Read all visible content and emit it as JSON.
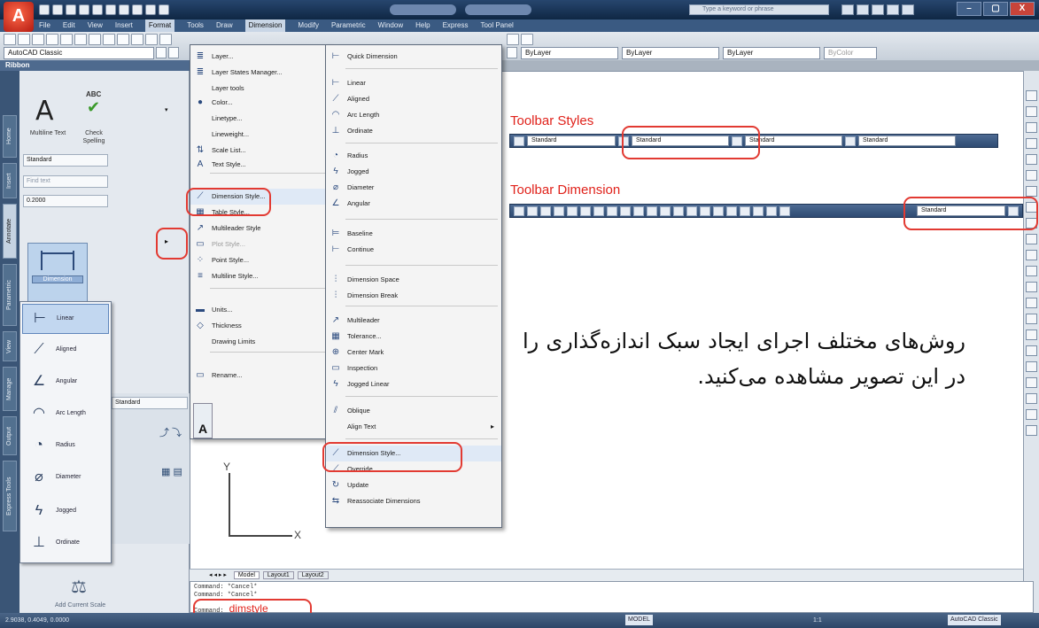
{
  "app": {
    "logo_letter": "A",
    "workspace": "AutoCAD Classic",
    "search_placeholder": "Type a keyword or phrase"
  },
  "window_buttons": [
    "–",
    "▢",
    "X"
  ],
  "menubar": [
    "File",
    "Edit",
    "View",
    "Insert",
    "Format",
    "Tools",
    "Draw",
    "Dimension",
    "Modify",
    "Parametric",
    "Window",
    "Help",
    "Express",
    "Tool Panel"
  ],
  "toolbar": {
    "layer_combo": "ByLayer",
    "linetype_combo": "ByLayer",
    "lineweight_combo": "ByLayer",
    "color_combo": "ByColor"
  },
  "ribbon": {
    "title": "Ribbon",
    "tabs": [
      "Home",
      "Insert",
      "Annotate",
      "Parametric",
      "View",
      "Manage",
      "Output",
      "Express Tools"
    ],
    "multiline_text": "Multiline Text",
    "check_spelling_abc": "ABC",
    "check_spelling": "Check Spelling",
    "text_style": "Standard",
    "find_text": "Find text",
    "text_height": "0.2000",
    "dimension_button": "Dimension",
    "dimension_list": [
      {
        "label": "Linear",
        "icon": "linear-dim-icon",
        "glyph": "⊢"
      },
      {
        "label": "Aligned",
        "icon": "aligned-dim-icon",
        "glyph": "⟋"
      },
      {
        "label": "Angular",
        "icon": "angular-dim-icon",
        "glyph": "∠"
      },
      {
        "label": "Arc Length",
        "icon": "arc-length-icon",
        "glyph": "◠"
      },
      {
        "label": "Radius",
        "icon": "radius-icon",
        "glyph": "◔"
      },
      {
        "label": "Diameter",
        "icon": "diameter-icon",
        "glyph": "⌀"
      },
      {
        "label": "Jogged",
        "icon": "jogged-icon",
        "glyph": "ϟ"
      },
      {
        "label": "Ordinate",
        "icon": "ordinate-icon",
        "glyph": "⊥"
      }
    ],
    "add_scale": "Add Current Scale",
    "sub_style": "Standard"
  },
  "format_menu": [
    {
      "label": "Layer...",
      "glyph": "≣"
    },
    {
      "label": "Layer States Manager...",
      "glyph": "≣"
    },
    {
      "label": "Layer tools",
      "glyph": ""
    },
    {
      "label": "Color...",
      "glyph": "●"
    },
    {
      "label": "Linetype...",
      "glyph": ""
    },
    {
      "label": "Lineweight...",
      "glyph": ""
    },
    {
      "label": "Scale List...",
      "glyph": "⇅"
    },
    {
      "label": "Text Style...",
      "glyph": "A"
    },
    {
      "label": "Dimension Style...",
      "glyph": "⟋"
    },
    {
      "label": "Table Style...",
      "glyph": "▦"
    },
    {
      "label": "Multileader Style",
      "glyph": "↗"
    },
    {
      "label": "Plot Style...",
      "glyph": "▭",
      "disabled": true
    },
    {
      "label": "Point Style...",
      "glyph": "⁘"
    },
    {
      "label": "Multiline Style...",
      "glyph": "≡"
    },
    {
      "label": "Units...",
      "glyph": "▬"
    },
    {
      "label": "Thickness",
      "glyph": "◇"
    },
    {
      "label": "Drawing Limits",
      "glyph": ""
    },
    {
      "label": "Rename...",
      "glyph": "▭"
    }
  ],
  "dimension_menu": [
    {
      "label": "Quick Dimension",
      "glyph": "⊢"
    },
    {
      "label": "Linear",
      "glyph": "⊢"
    },
    {
      "label": "Aligned",
      "glyph": "⟋"
    },
    {
      "label": "Arc Length",
      "glyph": "◠"
    },
    {
      "label": "Ordinate",
      "glyph": "⊥"
    },
    {
      "label": "Radius",
      "glyph": "◔"
    },
    {
      "label": "Jogged",
      "glyph": "ϟ"
    },
    {
      "label": "Diameter",
      "glyph": "⌀"
    },
    {
      "label": "Angular",
      "glyph": "∠"
    },
    {
      "label": "Baseline",
      "glyph": "⊨"
    },
    {
      "label": "Continue",
      "glyph": "⊢"
    },
    {
      "label": "Dimension Space",
      "glyph": "⫶"
    },
    {
      "label": "Dimension Break",
      "glyph": "⫶"
    },
    {
      "label": "Multileader",
      "glyph": "↗"
    },
    {
      "label": "Tolerance...",
      "glyph": "▦"
    },
    {
      "label": "Center Mark",
      "glyph": "⊕"
    },
    {
      "label": "Inspection",
      "glyph": "▭"
    },
    {
      "label": "Jogged Linear",
      "glyph": "ϟ"
    },
    {
      "label": "Oblique",
      "glyph": "⫽"
    },
    {
      "label": "Align Text",
      "glyph": "",
      "submenu": true
    },
    {
      "label": "Dimension Style...",
      "glyph": "⟋"
    },
    {
      "label": "Override",
      "glyph": "⟋"
    },
    {
      "label": "Update",
      "glyph": "↻"
    },
    {
      "label": "Reassociate Dimensions",
      "glyph": "⇆"
    }
  ],
  "annotations": {
    "toolbar_styles": "Toolbar Styles",
    "toolbar_dimension": "Toolbar Dimension",
    "command_typed": "dimstyle"
  },
  "styles_toolbar": {
    "text_style": "Standard",
    "dim_style": "Standard",
    "table_style": "Standard",
    "mleader_style": "Standard"
  },
  "dimension_toolbar": {
    "dim_style": "Standard"
  },
  "ucs": {
    "x": "X",
    "y": "Y"
  },
  "model_tabs": [
    "Model",
    "Layout1",
    "Layout2"
  ],
  "command_lines": [
    "Command: *Cancel*",
    "Command: *Cancel*"
  ],
  "command_prompt": "Command:",
  "status": {
    "coords": "2.9038, 0.4049, 0.0000",
    "model": "MODEL",
    "scale": "1:1",
    "workspace": "AutoCAD Classic"
  },
  "persian_text": "روش‌های مختلف اجرای ایجاد سبک اندازه‌گذاری را در این تصویر مشاهده می‌کنید.",
  "colors": {
    "annotation_red": "#e0221b",
    "titlebar": "#1b355a"
  }
}
